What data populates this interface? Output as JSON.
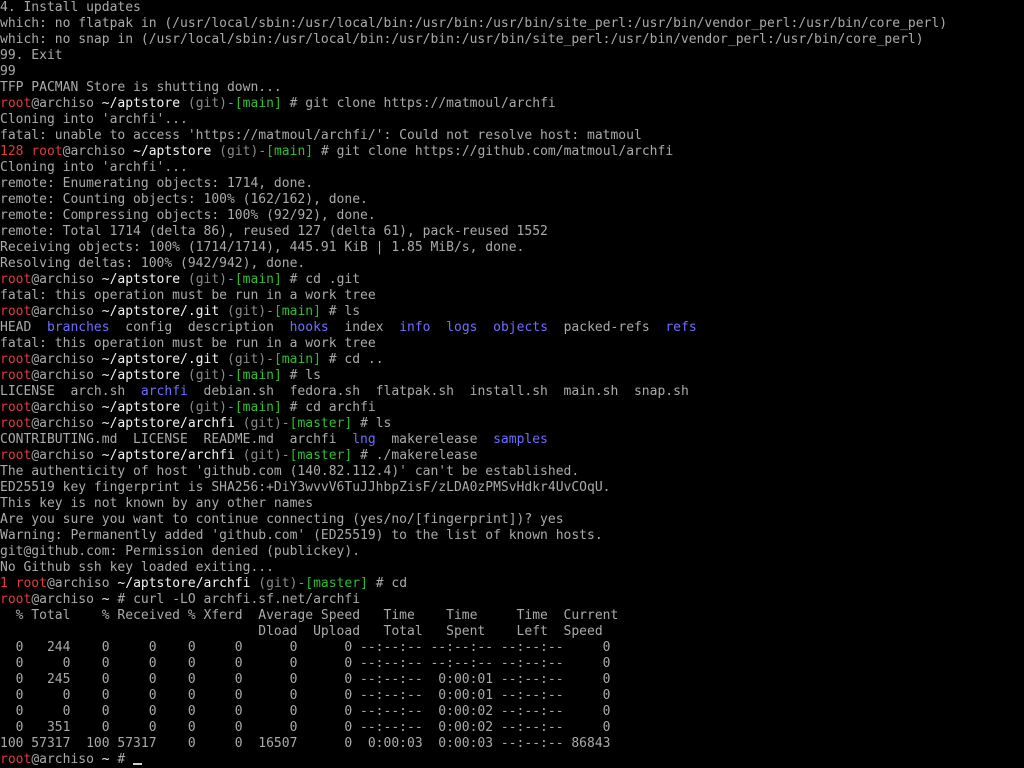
{
  "palette": {
    "background": "#000000",
    "default": "#aaaaaa",
    "red": "#e23a3a",
    "white": "#f2f2f2",
    "dim": "#8a8a8a",
    "green": "#2fbd34",
    "blue": "#6d6dff",
    "bright_green": "#55ff55"
  },
  "lines": [
    {
      "segments": [
        {
          "t": "4. Install updates",
          "c": "default"
        }
      ]
    },
    {
      "segments": [
        {
          "t": "which: no flatpak in (/usr/local/sbin:/usr/local/bin:/usr/bin:/usr/bin/site_perl:/usr/bin/vendor_perl:/usr/bin/core_perl)",
          "c": "default"
        }
      ]
    },
    {
      "segments": [
        {
          "t": "which: no snap in (/usr/local/sbin:/usr/local/bin:/usr/bin:/usr/bin/site_perl:/usr/bin/vendor_perl:/usr/bin/core_perl)",
          "c": "default"
        }
      ]
    },
    {
      "segments": [
        {
          "t": "99. Exit",
          "c": "default"
        }
      ]
    },
    {
      "segments": [
        {
          "t": "99",
          "c": "default"
        }
      ]
    },
    {
      "segments": [
        {
          "t": "TFP PACMAN Store is shutting down...",
          "c": "default"
        }
      ]
    },
    {
      "segments": [
        {
          "t": "root",
          "c": "red"
        },
        {
          "t": "@archiso ",
          "c": "default"
        },
        {
          "t": "~/aptstore",
          "c": "white"
        },
        {
          "t": " (git)-",
          "c": "dim"
        },
        {
          "t": "[main]",
          "c": "green"
        },
        {
          "t": " # git clone https://matmoul/archfi",
          "c": "default"
        }
      ]
    },
    {
      "segments": [
        {
          "t": "Cloning into 'archfi'...",
          "c": "default"
        }
      ]
    },
    {
      "segments": [
        {
          "t": "fatal: unable to access 'https://matmoul/archfi/': Could not resolve host: matmoul",
          "c": "default"
        }
      ]
    },
    {
      "segments": [
        {
          "t": "128 ",
          "c": "red"
        },
        {
          "t": "root",
          "c": "red"
        },
        {
          "t": "@archiso ",
          "c": "default"
        },
        {
          "t": "~/aptstore",
          "c": "white"
        },
        {
          "t": " (git)-",
          "c": "dim"
        },
        {
          "t": "[main]",
          "c": "green"
        },
        {
          "t": " # git clone https://github.com/matmoul/archfi",
          "c": "default"
        }
      ]
    },
    {
      "segments": [
        {
          "t": "Cloning into 'archfi'...",
          "c": "default"
        }
      ]
    },
    {
      "segments": [
        {
          "t": "remote: Enumerating objects: 1714, done.",
          "c": "default"
        }
      ]
    },
    {
      "segments": [
        {
          "t": "remote: Counting objects: 100% (162/162), done.",
          "c": "default"
        }
      ]
    },
    {
      "segments": [
        {
          "t": "remote: Compressing objects: 100% (92/92), done.",
          "c": "default"
        }
      ]
    },
    {
      "segments": [
        {
          "t": "remote: Total 1714 (delta 86), reused 127 (delta 61), pack-reused 1552",
          "c": "default"
        }
      ]
    },
    {
      "segments": [
        {
          "t": "Receiving objects: 100% (1714/1714), 445.91 KiB | 1.85 MiB/s, done.",
          "c": "default"
        }
      ]
    },
    {
      "segments": [
        {
          "t": "Resolving deltas: 100% (942/942), done.",
          "c": "default"
        }
      ]
    },
    {
      "segments": [
        {
          "t": "root",
          "c": "red"
        },
        {
          "t": "@archiso ",
          "c": "default"
        },
        {
          "t": "~/aptstore",
          "c": "white"
        },
        {
          "t": " (git)-",
          "c": "dim"
        },
        {
          "t": "[main]",
          "c": "green"
        },
        {
          "t": " # cd .git",
          "c": "default"
        }
      ]
    },
    {
      "segments": [
        {
          "t": "fatal: this operation must be run in a work tree",
          "c": "default"
        }
      ]
    },
    {
      "segments": [
        {
          "t": "root",
          "c": "red"
        },
        {
          "t": "@archiso ",
          "c": "default"
        },
        {
          "t": "~/aptstore/.git",
          "c": "white"
        },
        {
          "t": " (git)-",
          "c": "dim"
        },
        {
          "t": "[main]",
          "c": "green"
        },
        {
          "t": " # ls",
          "c": "default"
        }
      ]
    },
    {
      "segments": [
        {
          "t": "HEAD  ",
          "c": "default"
        },
        {
          "t": "branches",
          "c": "blue"
        },
        {
          "t": "  config  description  ",
          "c": "default"
        },
        {
          "t": "hooks",
          "c": "blue"
        },
        {
          "t": "  index  ",
          "c": "default"
        },
        {
          "t": "info",
          "c": "blue"
        },
        {
          "t": "  ",
          "c": "default"
        },
        {
          "t": "logs",
          "c": "blue"
        },
        {
          "t": "  ",
          "c": "default"
        },
        {
          "t": "objects",
          "c": "blue"
        },
        {
          "t": "  packed-refs  ",
          "c": "default"
        },
        {
          "t": "refs",
          "c": "blue"
        }
      ]
    },
    {
      "segments": [
        {
          "t": "fatal: this operation must be run in a work tree",
          "c": "default"
        }
      ]
    },
    {
      "segments": [
        {
          "t": "root",
          "c": "red"
        },
        {
          "t": "@archiso ",
          "c": "default"
        },
        {
          "t": "~/aptstore/.git",
          "c": "white"
        },
        {
          "t": " (git)-",
          "c": "dim"
        },
        {
          "t": "[main]",
          "c": "green"
        },
        {
          "t": " # cd ..",
          "c": "default"
        }
      ]
    },
    {
      "segments": [
        {
          "t": "root",
          "c": "red"
        },
        {
          "t": "@archiso ",
          "c": "default"
        },
        {
          "t": "~/aptstore",
          "c": "white"
        },
        {
          "t": " (git)-",
          "c": "dim"
        },
        {
          "t": "[main]",
          "c": "green"
        },
        {
          "t": " # ls",
          "c": "default"
        }
      ]
    },
    {
      "segments": [
        {
          "t": "LICENSE  arch.sh  ",
          "c": "default"
        },
        {
          "t": "archfi",
          "c": "blue"
        },
        {
          "t": "  debian.sh  fedora.sh  flatpak.sh  install.sh  main.sh  snap.sh",
          "c": "default"
        }
      ]
    },
    {
      "segments": [
        {
          "t": "root",
          "c": "red"
        },
        {
          "t": "@archiso ",
          "c": "default"
        },
        {
          "t": "~/aptstore",
          "c": "white"
        },
        {
          "t": " (git)-",
          "c": "dim"
        },
        {
          "t": "[main]",
          "c": "green"
        },
        {
          "t": " # cd archfi",
          "c": "default"
        }
      ]
    },
    {
      "segments": [
        {
          "t": "root",
          "c": "red"
        },
        {
          "t": "@archiso ",
          "c": "default"
        },
        {
          "t": "~/aptstore/archfi",
          "c": "white"
        },
        {
          "t": " (git)-",
          "c": "dim"
        },
        {
          "t": "[master]",
          "c": "green"
        },
        {
          "t": " # ls",
          "c": "default"
        }
      ]
    },
    {
      "segments": [
        {
          "t": "CONTRIBUTING.md  LICENSE  README.md  archfi  ",
          "c": "default"
        },
        {
          "t": "lng",
          "c": "blue"
        },
        {
          "t": "  ",
          "c": "default"
        },
        {
          "t": "makerelease",
          "c": "bright_green"
        },
        {
          "t": "  ",
          "c": "default"
        },
        {
          "t": "samples",
          "c": "blue"
        }
      ]
    },
    {
      "segments": [
        {
          "t": "root",
          "c": "red"
        },
        {
          "t": "@archiso ",
          "c": "default"
        },
        {
          "t": "~/aptstore/archfi",
          "c": "white"
        },
        {
          "t": " (git)-",
          "c": "dim"
        },
        {
          "t": "[master]",
          "c": "green"
        },
        {
          "t": " # ./makerelease",
          "c": "default"
        }
      ]
    },
    {
      "segments": [
        {
          "t": "The authenticity of host 'github.com (140.82.112.4)' can't be established.",
          "c": "default"
        }
      ]
    },
    {
      "segments": [
        {
          "t": "ED25519 key fingerprint is SHA256:+DiY3wvvV6TuJJhbpZisF/zLDA0zPMSvHdkr4UvCOqU.",
          "c": "default"
        }
      ]
    },
    {
      "segments": [
        {
          "t": "This key is not known by any other names",
          "c": "default"
        }
      ]
    },
    {
      "segments": [
        {
          "t": "Are you sure you want to continue connecting (yes/no/[fingerprint])? yes",
          "c": "default"
        }
      ]
    },
    {
      "segments": [
        {
          "t": "Warning: Permanently added 'github.com' (ED25519) to the list of known hosts.",
          "c": "default"
        }
      ]
    },
    {
      "segments": [
        {
          "t": "git@github.com: Permission denied (publickey).",
          "c": "default"
        }
      ]
    },
    {
      "segments": [
        {
          "t": "No Github ssh key loaded exiting...",
          "c": "default"
        }
      ]
    },
    {
      "segments": [
        {
          "t": "1 ",
          "c": "red"
        },
        {
          "t": "root",
          "c": "red"
        },
        {
          "t": "@archiso ",
          "c": "default"
        },
        {
          "t": "~/aptstore/archfi",
          "c": "white"
        },
        {
          "t": " (git)-",
          "c": "dim"
        },
        {
          "t": "[master]",
          "c": "green"
        },
        {
          "t": " # cd",
          "c": "default"
        }
      ]
    },
    {
      "segments": [
        {
          "t": "root",
          "c": "red"
        },
        {
          "t": "@archiso ",
          "c": "default"
        },
        {
          "t": "~",
          "c": "white"
        },
        {
          "t": " # curl -LO archfi.sf.net/archfi",
          "c": "default"
        }
      ]
    },
    {
      "segments": [
        {
          "t": "  % Total    % Received % Xferd  Average Speed   Time    Time     Time  Current",
          "c": "default"
        }
      ]
    },
    {
      "segments": [
        {
          "t": "                                 Dload  Upload   Total   Spent    Left  Speed",
          "c": "default"
        }
      ]
    },
    {
      "segments": [
        {
          "t": "  0   244    0     0    0     0      0      0 --:--:-- --:--:-- --:--:--     0",
          "c": "default"
        }
      ]
    },
    {
      "segments": [
        {
          "t": "  0     0    0     0    0     0      0      0 --:--:-- --:--:-- --:--:--     0",
          "c": "default"
        }
      ]
    },
    {
      "segments": [
        {
          "t": "  0   245    0     0    0     0      0      0 --:--:--  0:00:01 --:--:--     0",
          "c": "default"
        }
      ]
    },
    {
      "segments": [
        {
          "t": "  0     0    0     0    0     0      0      0 --:--:--  0:00:01 --:--:--     0",
          "c": "default"
        }
      ]
    },
    {
      "segments": [
        {
          "t": "  0     0    0     0    0     0      0      0 --:--:--  0:00:02 --:--:--     0",
          "c": "default"
        }
      ]
    },
    {
      "segments": [
        {
          "t": "  0   351    0     0    0     0      0      0 --:--:--  0:00:02 --:--:--     0",
          "c": "default"
        }
      ]
    },
    {
      "segments": [
        {
          "t": "100 57317  100 57317    0     0  16507      0  0:00:03  0:00:03 --:--:-- 86843",
          "c": "default"
        }
      ]
    },
    {
      "segments": [
        {
          "t": "root",
          "c": "red"
        },
        {
          "t": "@archiso ",
          "c": "default"
        },
        {
          "t": "~",
          "c": "white"
        },
        {
          "t": " # ",
          "c": "default"
        }
      ],
      "cursor": true
    }
  ]
}
